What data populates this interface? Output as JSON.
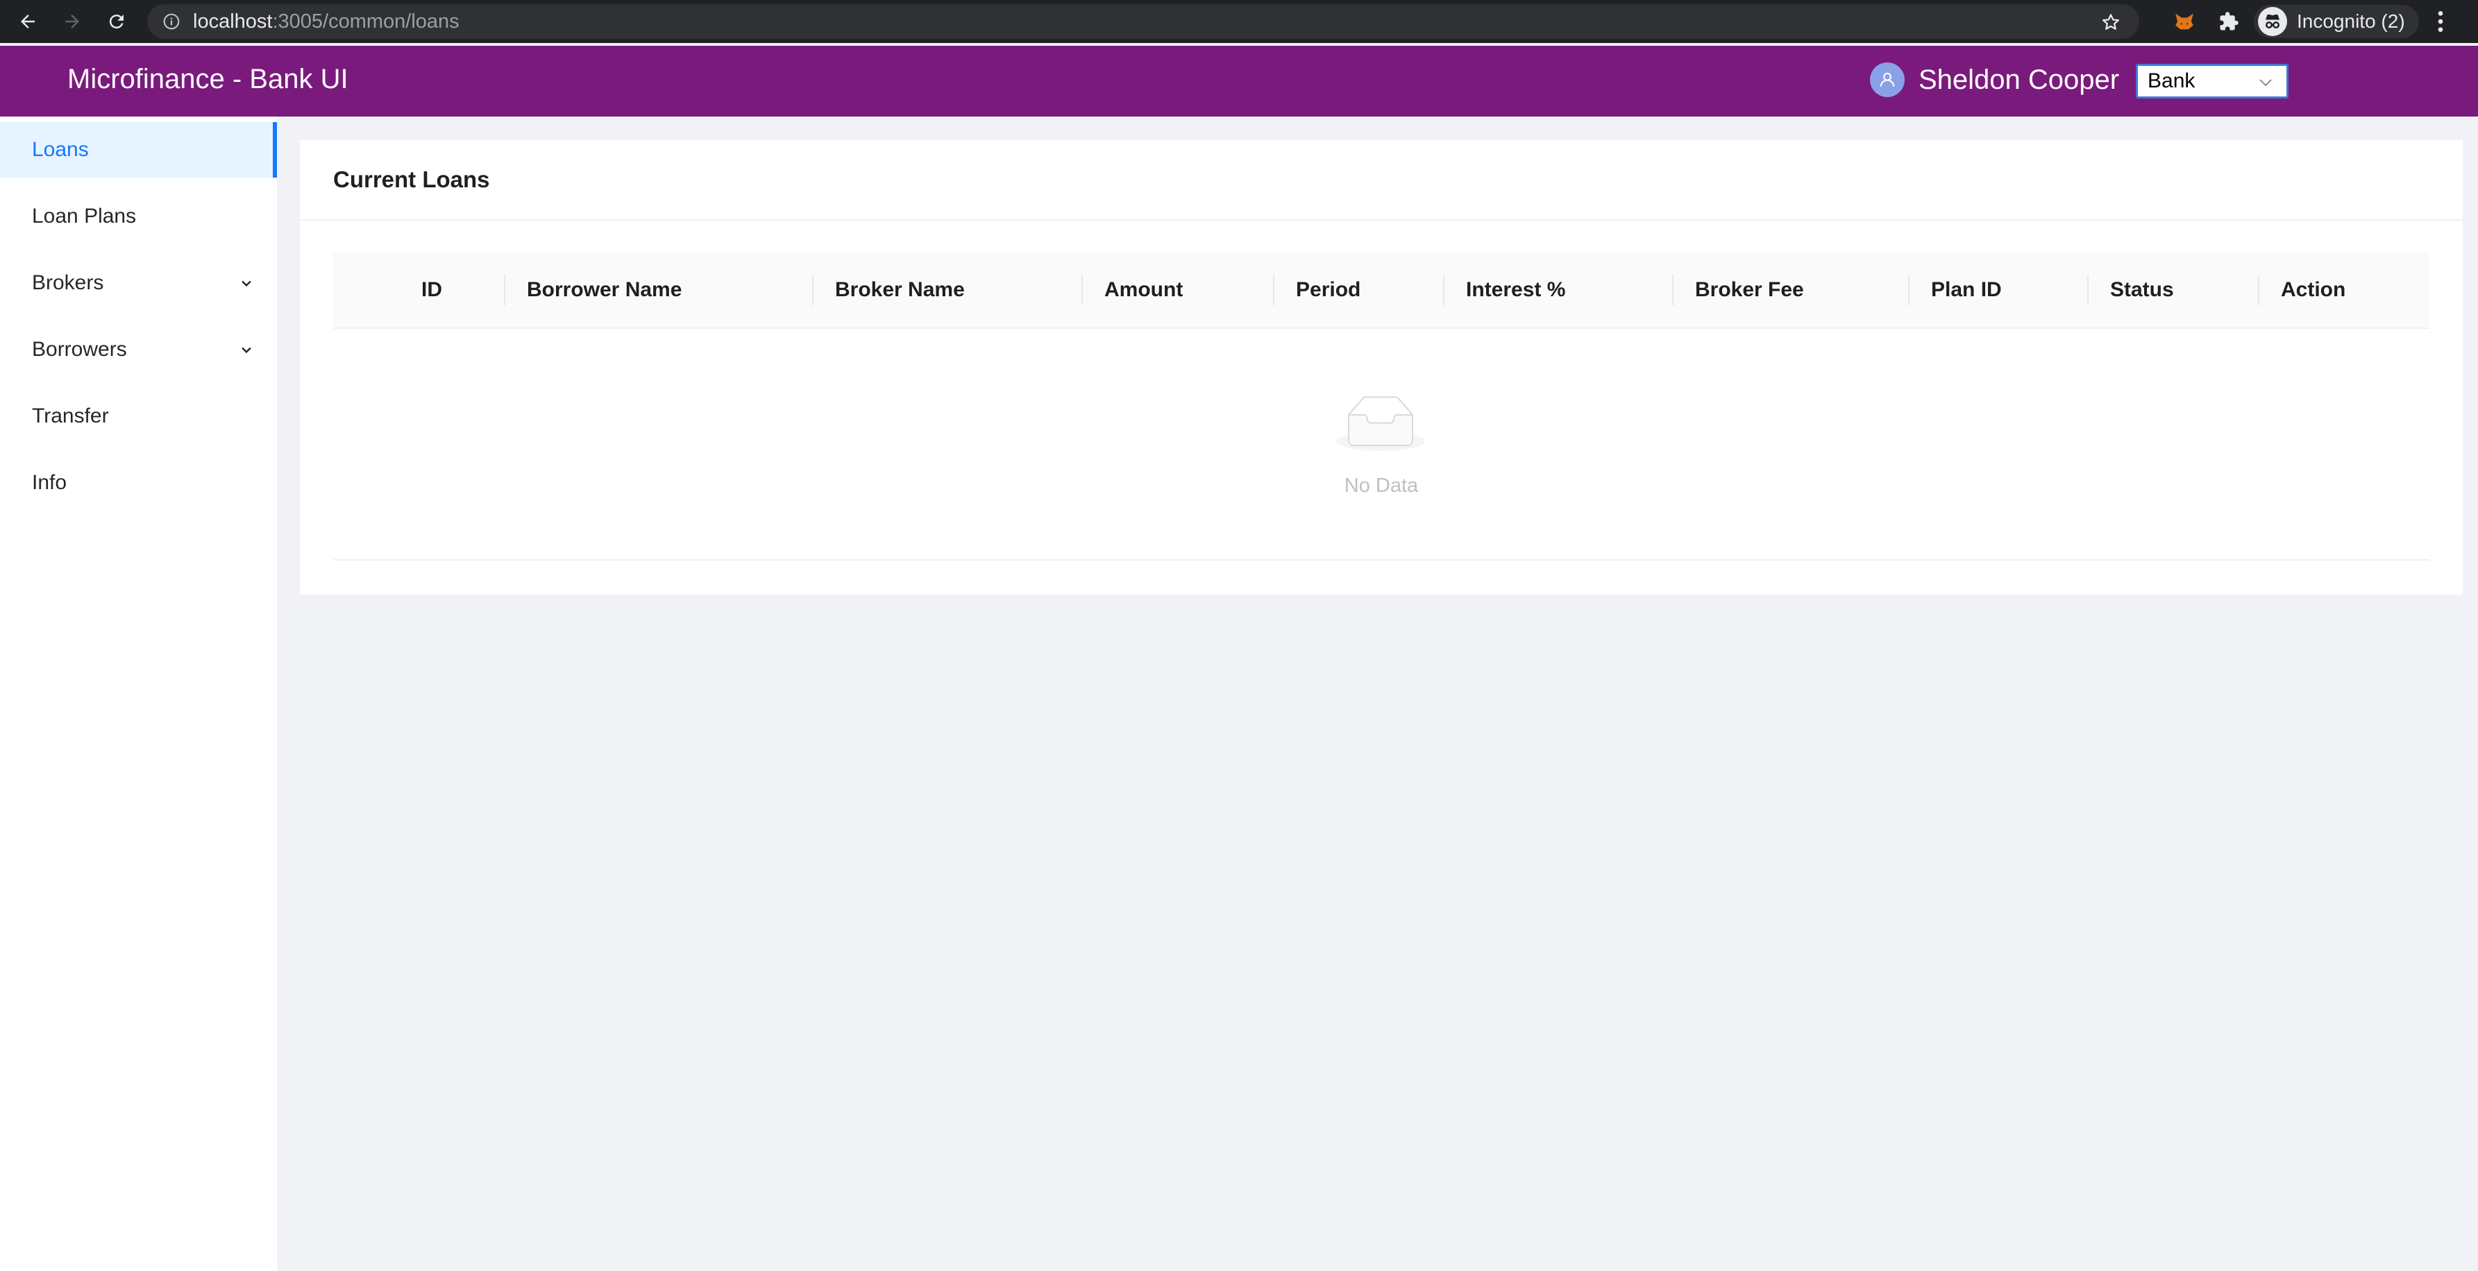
{
  "browser": {
    "url_host": "localhost",
    "url_path": ":3005/common/loans",
    "profile_label": "Incognito (2)",
    "icons": [
      "back-icon",
      "forward-icon",
      "reload-icon",
      "info-icon",
      "star-icon",
      "fox-extension-icon",
      "puzzle-icon",
      "incognito-icon",
      "kebab-menu-icon"
    ]
  },
  "header": {
    "title": "Microfinance - Bank UI",
    "user_name": "Sheldon Cooper",
    "role_select": {
      "selected": "Bank"
    },
    "brand_color": "#7a1a7c"
  },
  "sidebar": {
    "items": [
      {
        "label": "Loans",
        "active": true,
        "expandable": false
      },
      {
        "label": "Loan Plans",
        "active": false,
        "expandable": false
      },
      {
        "label": "Brokers",
        "active": false,
        "expandable": true
      },
      {
        "label": "Borrowers",
        "active": false,
        "expandable": true
      },
      {
        "label": "Transfer",
        "active": false,
        "expandable": false
      },
      {
        "label": "Info",
        "active": false,
        "expandable": false
      }
    ],
    "accent_color": "#1677ff"
  },
  "main": {
    "card_title": "Current Loans",
    "table": {
      "columns": [
        "ID",
        "Borrower Name",
        "Broker Name",
        "Amount",
        "Period",
        "Interest %",
        "Broker Fee",
        "Plan ID",
        "Status",
        "Action"
      ],
      "rows": [],
      "empty_text": "No Data"
    }
  }
}
